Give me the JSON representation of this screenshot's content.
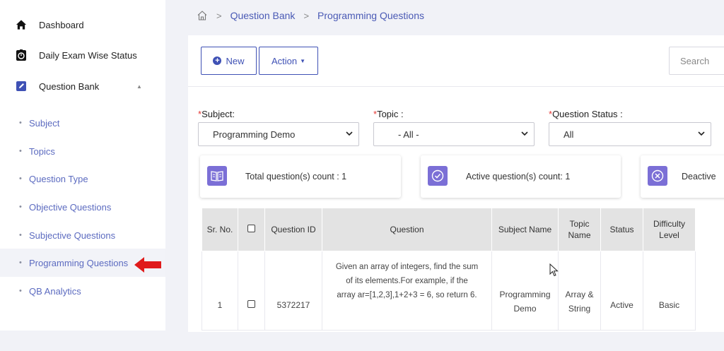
{
  "sidebar": {
    "main_items": [
      {
        "label": "Dashboard",
        "icon": "home-icon"
      },
      {
        "label": "Daily Exam Wise Status",
        "icon": "stopwatch-icon"
      },
      {
        "label": "Question Bank",
        "icon": "edit-icon"
      }
    ],
    "sub_items": [
      {
        "label": "Subject"
      },
      {
        "label": "Topics"
      },
      {
        "label": "Question Type"
      },
      {
        "label": "Objective Questions"
      },
      {
        "label": "Subjective Questions"
      },
      {
        "label": "Programming Questions"
      },
      {
        "label": "QB Analytics"
      }
    ],
    "active_sub": "Programming Questions"
  },
  "breadcrumb": {
    "icon": "home-outline-icon",
    "items": [
      "Question Bank",
      "Programming Questions"
    ]
  },
  "toolbar": {
    "new_label": "New",
    "action_label": "Action",
    "search_placeholder": "Search"
  },
  "filters": [
    {
      "label": "Subject:",
      "value": "Programming Demo"
    },
    {
      "label": "Topic :",
      "value": "- All -"
    },
    {
      "label": "Question Status :",
      "value": "All"
    }
  ],
  "stats": [
    {
      "text": "Total question(s) count : 1",
      "icon": "book-icon"
    },
    {
      "text": "Active question(s) count: 1",
      "icon": "check-circle-icon"
    },
    {
      "text": "Deactive",
      "icon": "x-circle-icon"
    }
  ],
  "table": {
    "headers": [
      "Sr. No.",
      "",
      "Question ID",
      "Question",
      "Subject Name",
      "Topic Name",
      "Status",
      "Difficulty Level"
    ],
    "rows": [
      {
        "sr": "1",
        "id": "5372217",
        "question_lines": [
          "Given an array of integers, find the sum",
          "of its elements.For example, if the",
          "array ar=[1,2,3],1+2+3 = 6, so return 6."
        ],
        "subject": "Programming Demo",
        "topic": "Array & String",
        "status": "Active",
        "difficulty": "Basic"
      }
    ]
  },
  "colors": {
    "accent": "#3f51b5",
    "link": "#5c6bc0",
    "stat_icon_bg": "#7b6fd6",
    "required": "#e53935",
    "pointer_arrow": "#e53935"
  }
}
